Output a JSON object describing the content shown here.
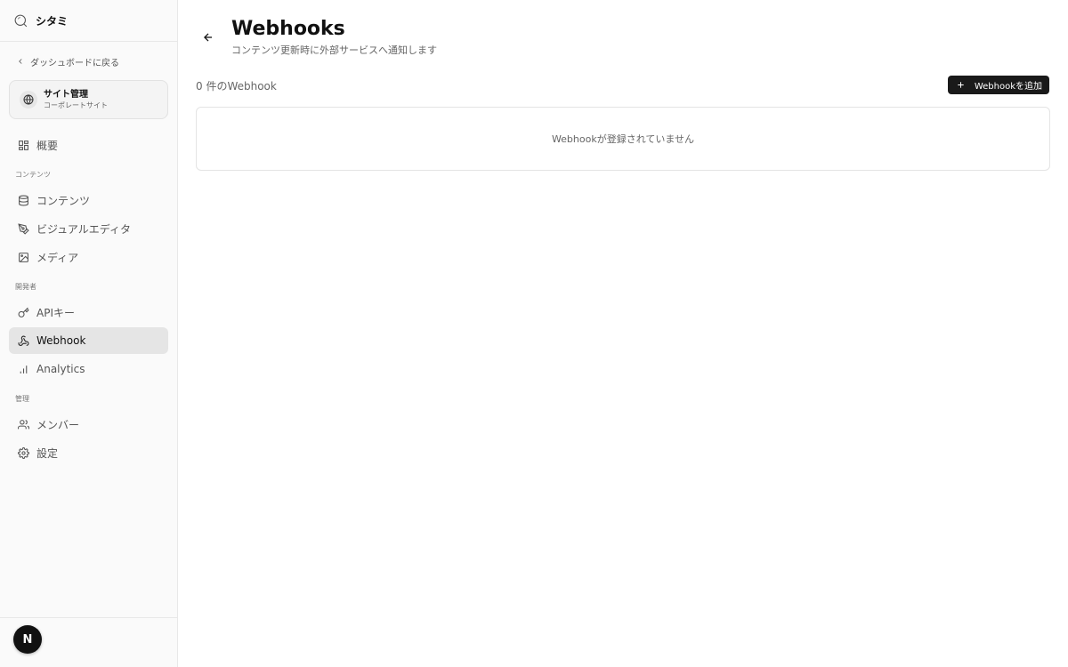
{
  "brand": {
    "name": "シタミ",
    "icon": "search-icon"
  },
  "back_link": {
    "label": "ダッシュボードに戻る",
    "icon": "chevron-left-icon"
  },
  "site_card": {
    "title": "サイト管理",
    "subtitle": "コーポレートサイト",
    "icon": "globe-icon"
  },
  "nav": {
    "overview": {
      "label": "概要",
      "icon": "layout-grid-icon"
    },
    "section_content": "コンテンツ",
    "content": {
      "label": "コンテンツ",
      "icon": "database-icon"
    },
    "visual_editor": {
      "label": "ビジュアルエディタ",
      "icon": "pen-tool-icon"
    },
    "media": {
      "label": "メディア",
      "icon": "image-icon"
    },
    "section_developer": "開発者",
    "api_keys": {
      "label": "APIキー",
      "icon": "key-icon"
    },
    "webhook": {
      "label": "Webhook",
      "icon": "webhook-icon",
      "active": true
    },
    "analytics": {
      "label": "Analytics",
      "icon": "bar-chart-icon"
    },
    "section_admin": "管理",
    "members": {
      "label": "メンバー",
      "icon": "users-icon"
    },
    "settings": {
      "label": "設定",
      "icon": "gear-icon"
    }
  },
  "user": {
    "avatar_initial": "N"
  },
  "main": {
    "title": "Webhooks",
    "subtitle": "コンテンツ更新時に外部サービスへ通知します",
    "count_label": "0 件のWebhook",
    "add_button": "Webhookを追加",
    "empty_message": "Webhookが登録されていません"
  },
  "colors": {
    "accent": "#1a1a1a",
    "active_nav_bg": "#e5e5e5",
    "sidebar_bg": "#fafafa"
  }
}
